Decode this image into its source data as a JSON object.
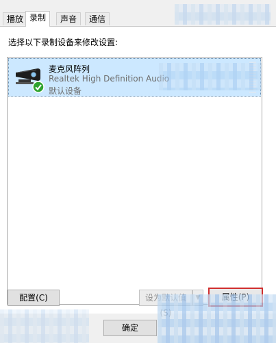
{
  "tabs": [
    {
      "label": "播放",
      "active": false
    },
    {
      "label": "录制",
      "active": true
    },
    {
      "label": "声音",
      "active": false
    },
    {
      "label": "通信",
      "active": false
    }
  ],
  "instruction": "选择以下录制设备来修改设置:",
  "devices": [
    {
      "name": "麦克风阵列",
      "driver": "Realtek High Definition Audio",
      "status": "默认设备",
      "icon": "microphone-array-icon",
      "default_badge": "check-icon",
      "selected": true
    }
  ],
  "buttons": {
    "configure": "配置(C)",
    "set_default": "设为默认值(S)",
    "properties": "属性(P)",
    "ok": "确定"
  },
  "colors": {
    "selection": "#cce8ff",
    "highlight_border": "#d02e2e",
    "check": "#2ea32e"
  }
}
